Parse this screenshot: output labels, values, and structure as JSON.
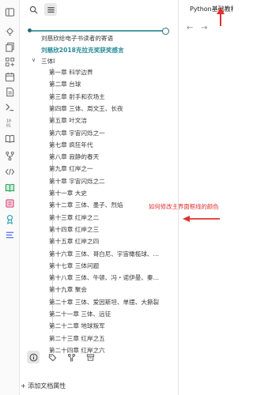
{
  "outline": {
    "items": [
      {
        "text": "刘慈欣给电子书读者的寄语",
        "level": 0,
        "style": "normal"
      },
      {
        "text": "刘慈欣2018克拉克奖获奖感言",
        "level": 0,
        "style": "teal"
      },
      {
        "text": "三体I",
        "level": 0,
        "style": "normal",
        "toggle": "∨"
      },
      {
        "text": "第一章 科学边界",
        "level": 1
      },
      {
        "text": "第二章 台球",
        "level": 1
      },
      {
        "text": "第三章 射手和农场主",
        "level": 1
      },
      {
        "text": "第四章 三体、周文王、长夜",
        "level": 1
      },
      {
        "text": "第五章 叶文洁",
        "level": 1
      },
      {
        "text": "第六章 宇宙闪烁之一",
        "level": 1
      },
      {
        "text": "第七章 疯狂年代",
        "level": 1
      },
      {
        "text": "第八章 寂静的春天",
        "level": 1
      },
      {
        "text": "第九章 红岸之一",
        "level": 1
      },
      {
        "text": "第十章 宇宙闪烁之二",
        "level": 1
      },
      {
        "text": "第十一章 大史",
        "level": 1
      },
      {
        "text": "第十二章 三体、墨子、烈焰",
        "level": 1
      },
      {
        "text": "第十三章 红岸之二",
        "level": 1
      },
      {
        "text": "第十四章 红岸之三",
        "level": 1
      },
      {
        "text": "第十五章 红岸之四",
        "level": 1
      },
      {
        "text": "第十六章 三体、哥白尼、宇宙橄榄球、…",
        "level": 1
      },
      {
        "text": "第十七章 三体问题",
        "level": 1
      },
      {
        "text": "第十八章 三体、牛顿、冯・诺伊曼、秦…",
        "level": 1
      },
      {
        "text": "第十九章 聚会",
        "level": 1
      },
      {
        "text": "第二十章 三体、爱因斯坦、单摆、大撕裂",
        "level": 1
      },
      {
        "text": "第二十一章 三体、远征",
        "level": 1
      },
      {
        "text": "第二十二章 地球叛军",
        "level": 1
      },
      {
        "text": "第二十三章 红岸之五",
        "level": 1
      },
      {
        "text": "第二十四章 红岸之六",
        "level": 1
      }
    ]
  },
  "add_property_label": "+ 添加文档属性",
  "editor": {
    "title": "Python基础教程",
    "back": "←",
    "forward": "→"
  },
  "annotation": {
    "text": "如何修改主界面框线的颜色",
    "color": "#e03030"
  }
}
